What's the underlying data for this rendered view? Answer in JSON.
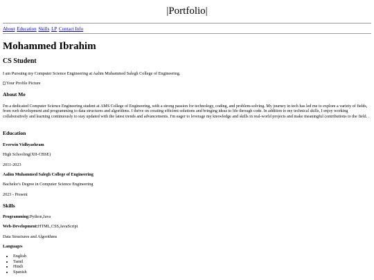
{
  "header": {
    "title": "|Portfolio|"
  },
  "nav": {
    "items": [
      {
        "label": "About"
      },
      {
        "label": "Education"
      },
      {
        "label": "Skills"
      },
      {
        "label": "LP"
      },
      {
        "label": "Contact Info"
      }
    ]
  },
  "hero": {
    "name": "Mohammed Ibrahim",
    "role": "CS Student",
    "intro": "I am Pursuing my Computer Science Engineering at Aalim Muhammed Salegh College of Engineering.",
    "profile_image_alt": "Your Profile Picture"
  },
  "about": {
    "heading": "About Me",
    "text": "I'm a dedicated Computer Science Engineering student at AMS College of Engineering, with a strong passion for technology, coding, and problem-solving. My journey in tech has led me to explore a variety of fields, from web development and programming to data structures and algorithms. I thrive on creating efficient solutions and bringing ideas to life through code. In addition to my technical skills, I enjoy working collaboratively and learning continuously to stay updated with the latest trends and advancements. I'm eager to leverage my knowledge and skills in real-world projects and make meaningful contributions to the field. ."
  },
  "education": {
    "heading": "Education",
    "entries": [
      {
        "school": "Everwin Vidhyashram",
        "degree": "High Schooling(XII-CBSE)",
        "years": "2011-2023"
      },
      {
        "school": "Aalim Muhammed Salegh College of Engineering",
        "degree": "Bachelor's Degree in Computer Science Engineering",
        "years": "2023 - Present"
      }
    ]
  },
  "skills": {
    "heading": "Skills",
    "programming_label": "Programming:",
    "programming_value": "Python,Java",
    "web_label": "Web-Development:",
    "web_value": "HTML,CSS,JavaScript",
    "dsa": "Data Structures and Algorithms",
    "languages_heading": "Languages",
    "languages": [
      "English",
      "Tamil",
      "Hindi",
      "Spanish"
    ]
  }
}
